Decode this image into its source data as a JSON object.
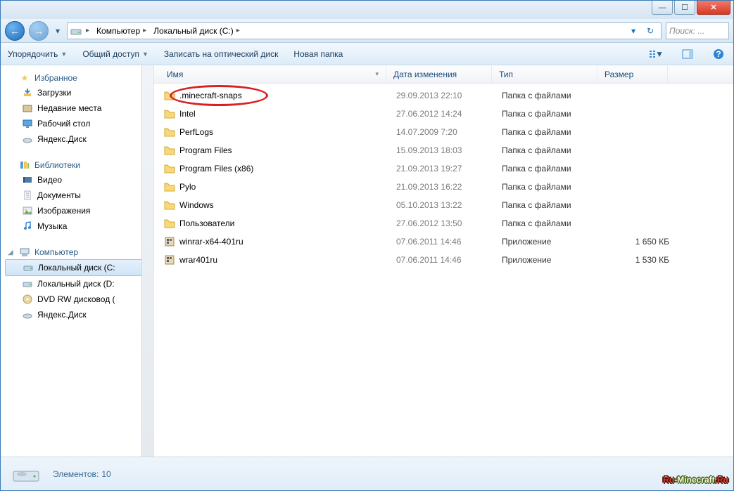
{
  "breadcrumbs": [
    {
      "label": "Компьютер"
    },
    {
      "label": "Локальный диск (C:)"
    }
  ],
  "search_placeholder": "Поиск: ...",
  "toolbar": {
    "organize": "Упорядочить",
    "share": "Общий доступ",
    "burn": "Записать на оптический диск",
    "newfolder": "Новая папка"
  },
  "columns": {
    "name": "Имя",
    "date": "Дата изменения",
    "type": "Тип",
    "size": "Размер"
  },
  "sidebar": {
    "favorites": {
      "label": "Избранное",
      "items": [
        {
          "label": "Загрузки",
          "icon": "download"
        },
        {
          "label": "Недавние места",
          "icon": "recent"
        },
        {
          "label": "Рабочий стол",
          "icon": "desktop"
        },
        {
          "label": "Яндекс.Диск",
          "icon": "ydisk"
        }
      ]
    },
    "libraries": {
      "label": "Библиотеки",
      "items": [
        {
          "label": "Видео",
          "icon": "video"
        },
        {
          "label": "Документы",
          "icon": "docs"
        },
        {
          "label": "Изображения",
          "icon": "images"
        },
        {
          "label": "Музыка",
          "icon": "music"
        }
      ]
    },
    "computer": {
      "label": "Компьютер",
      "items": [
        {
          "label": "Локальный диск (C:",
          "icon": "drive",
          "selected": true
        },
        {
          "label": "Локальный диск (D:",
          "icon": "drive"
        },
        {
          "label": "DVD RW дисковод (",
          "icon": "disc"
        },
        {
          "label": "Яндекс.Диск",
          "icon": "ydisk"
        }
      ]
    }
  },
  "files": [
    {
      "name": ".minecraft-snaps",
      "date": "29.09.2013 22:10",
      "type": "Папка с файлами",
      "size": "",
      "icon": "folder",
      "circled": true
    },
    {
      "name": "Intel",
      "date": "27.06.2012 14:24",
      "type": "Папка с файлами",
      "size": "",
      "icon": "folder"
    },
    {
      "name": "PerfLogs",
      "date": "14.07.2009 7:20",
      "type": "Папка с файлами",
      "size": "",
      "icon": "folder"
    },
    {
      "name": "Program Files",
      "date": "15.09.2013 18:03",
      "type": "Папка с файлами",
      "size": "",
      "icon": "folder"
    },
    {
      "name": "Program Files (x86)",
      "date": "21.09.2013 19:27",
      "type": "Папка с файлами",
      "size": "",
      "icon": "folder"
    },
    {
      "name": "Pylo",
      "date": "21.09.2013 16:22",
      "type": "Папка с файлами",
      "size": "",
      "icon": "folder"
    },
    {
      "name": "Windows",
      "date": "05.10.2013 13:22",
      "type": "Папка с файлами",
      "size": "",
      "icon": "folder"
    },
    {
      "name": "Пользователи",
      "date": "27.06.2012 13:50",
      "type": "Папка с файлами",
      "size": "",
      "icon": "folder"
    },
    {
      "name": "winrar-x64-401ru",
      "date": "07.06.2011 14:46",
      "type": "Приложение",
      "size": "1 650 КБ",
      "icon": "exe"
    },
    {
      "name": "wrar401ru",
      "date": "07.06.2011 14:46",
      "type": "Приложение",
      "size": "1 530 КБ",
      "icon": "exe"
    }
  ],
  "status": {
    "label": "Элементов:",
    "count": "10"
  },
  "watermark": {
    "t1": "Ru",
    "t2": "-Minecraft",
    "t3": ".Ru"
  }
}
